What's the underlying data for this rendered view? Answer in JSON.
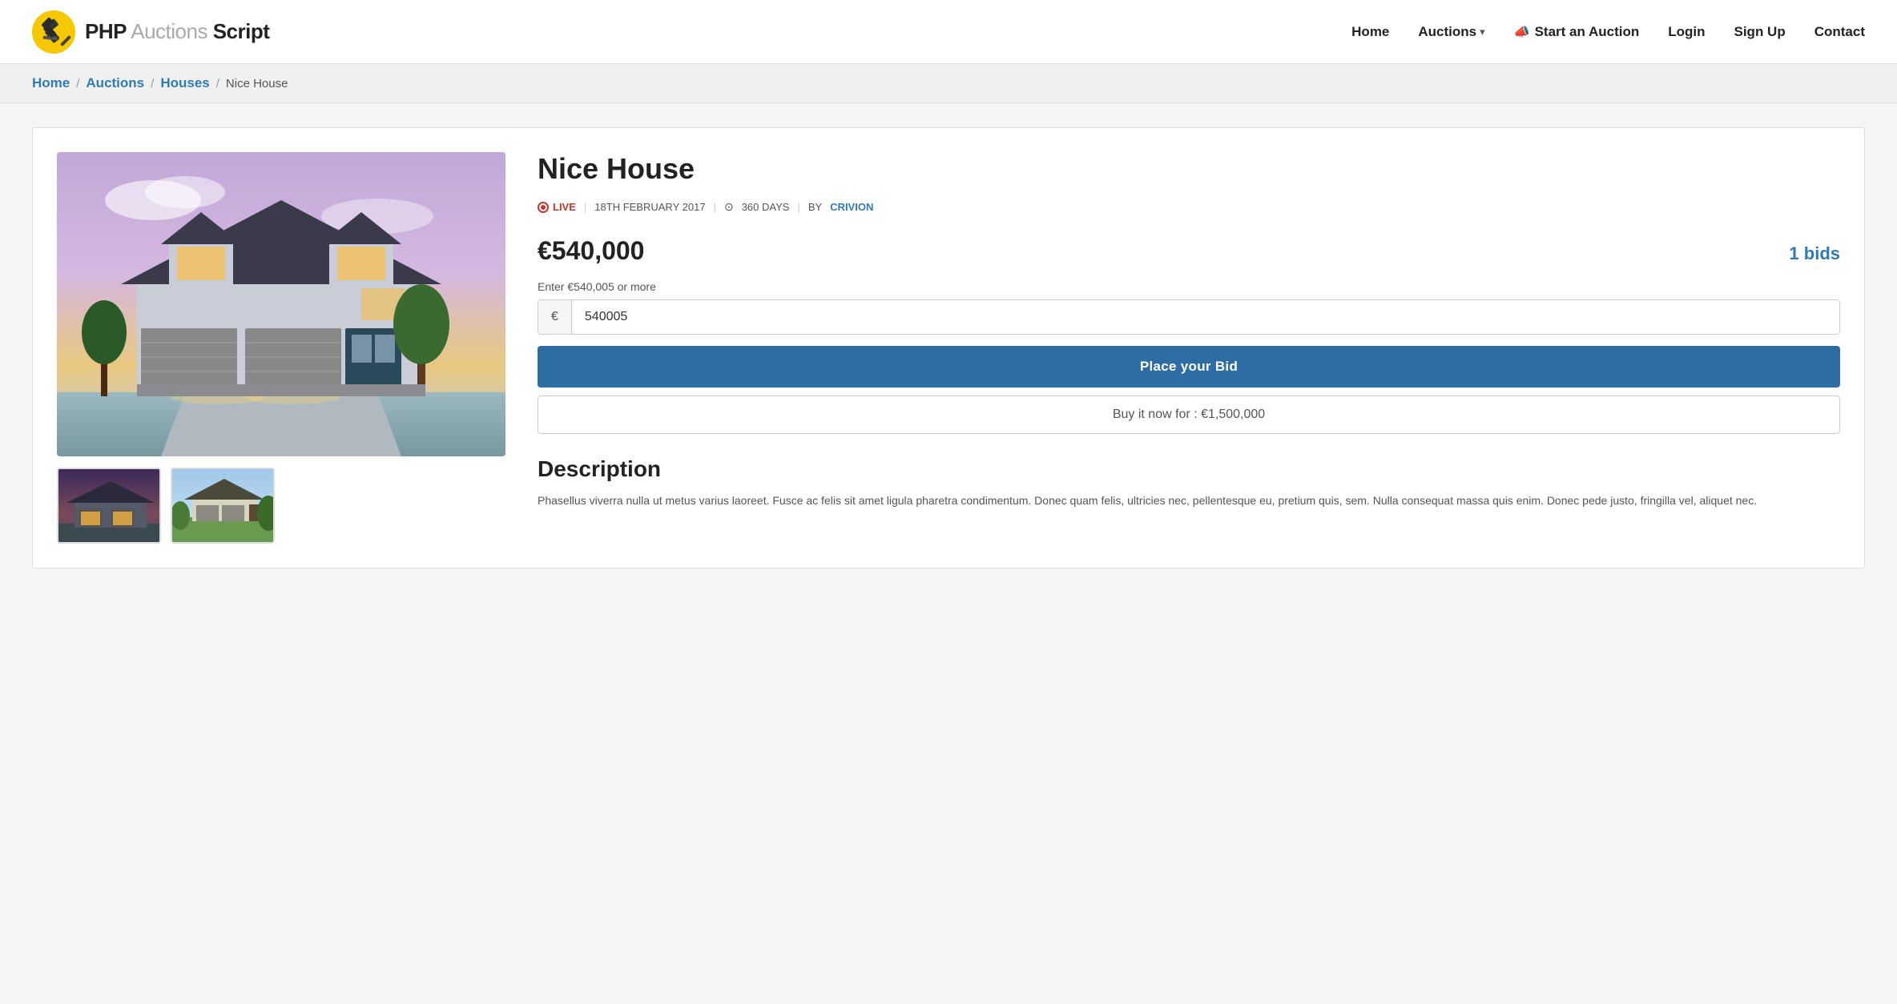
{
  "site": {
    "logo_php": "PHP",
    "logo_auctions": " Auctions ",
    "logo_script": "Script"
  },
  "nav": {
    "home": "Home",
    "auctions": "Auctions",
    "start_auction": "Start an Auction",
    "login": "Login",
    "signup": "Sign Up",
    "contact": "Contact"
  },
  "breadcrumb": {
    "home": "Home",
    "auctions": "Auctions",
    "houses": "Houses",
    "current": "Nice House",
    "sep": "/"
  },
  "auction": {
    "title": "Nice House",
    "status": "LIVE",
    "date": "18TH FEBRUARY 2017",
    "days": "360 DAYS",
    "by_label": "BY",
    "by_user": "CRIVION",
    "price": "€540,000",
    "bids": "1 bids",
    "bid_prompt": "Enter €540,005 or more",
    "euro_symbol": "€",
    "bid_value": "540005",
    "place_bid_label": "Place your Bid",
    "buy_now_label": "Buy it now for : €1,500,000",
    "description_title": "Description",
    "description_text": "Phasellus viverra nulla ut metus varius laoreet. Fusce ac felis sit amet ligula pharetra condimentum. Donec quam felis, ultricies nec, pellentesque eu, pretium quis, sem. Nulla consequat massa quis enim. Donec pede justo, fringilla vel, aliquet nec."
  },
  "colors": {
    "accent_blue": "#2e6da4",
    "link_blue": "#2e7bb5",
    "live_red": "#c0392b"
  }
}
